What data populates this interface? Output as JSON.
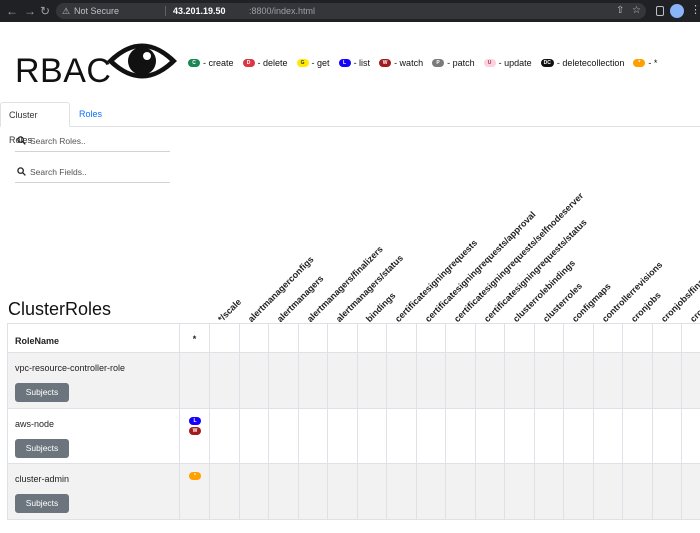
{
  "browser": {
    "security_label": "Not Secure",
    "host": "43.201.19.50",
    "path": ":8800/index.html"
  },
  "app": {
    "title": "RBAC",
    "logo_icon": "eye-icon"
  },
  "legend": [
    {
      "abbr": "C",
      "label": "- create",
      "bg": "#198754",
      "fg": "#ffffff"
    },
    {
      "abbr": "D",
      "label": "- delete",
      "bg": "#dc3545",
      "fg": "#ffffff"
    },
    {
      "abbr": "G",
      "label": "- get",
      "bg": "#ffeb00",
      "fg": "#333333"
    },
    {
      "abbr": "L",
      "label": "- list",
      "bg": "#1400ff",
      "fg": "#ffffff"
    },
    {
      "abbr": "W",
      "label": "- watch",
      "bg": "#a11d1d",
      "fg": "#ffffff"
    },
    {
      "abbr": "P",
      "label": "- patch",
      "bg": "#7a7a7a",
      "fg": "#ffffff"
    },
    {
      "abbr": "U",
      "label": "- update",
      "bg": "#ffd1dc",
      "fg": "#a33a55"
    },
    {
      "abbr": "DC",
      "label": "- deletecollection",
      "bg": "#111111",
      "fg": "#ffffff"
    },
    {
      "abbr": "*",
      "label": "- *",
      "bg": "#ff9f00",
      "fg": "#ffffff"
    }
  ],
  "tabs": [
    {
      "label": "Cluster Roles",
      "active": true
    },
    {
      "label": "Roles",
      "active": false
    }
  ],
  "search": {
    "roles_placeholder": "Search Roles..",
    "fields_placeholder": "Search Fields.."
  },
  "section_title": "ClusterRoles",
  "table": {
    "role_header": "RoleName",
    "star_header": "*",
    "columns": [
      "*/scale",
      "alertmanagerconfigs",
      "alertmanagers",
      "alertmanagers/finalizers",
      "alertmanagers/status",
      "bindings",
      "certificatesigningrequests",
      "certificatesigningrequests/approval",
      "certificatesigningrequests/selfnodeserver",
      "certificatesigningrequests/status",
      "clusterrolebindings",
      "clusterroles",
      "configmaps",
      "controllerrevisions",
      "cronjobs",
      "cronjobs/finalizers",
      "cronjobs/status"
    ],
    "subjects_label": "Subjects",
    "rows": [
      {
        "name": "vpc-resource-controller-role",
        "star_badges": []
      },
      {
        "name": "aws-node",
        "star_badges": [
          {
            "abbr": "L",
            "bg": "#1400ff",
            "fg": "#ffffff"
          },
          {
            "abbr": "W",
            "bg": "#a11d1d",
            "fg": "#ffffff"
          }
        ]
      },
      {
        "name": "cluster-admin",
        "star_badges": [
          {
            "abbr": "*",
            "bg": "#ff9f00",
            "fg": "#ffffff"
          }
        ]
      }
    ]
  }
}
